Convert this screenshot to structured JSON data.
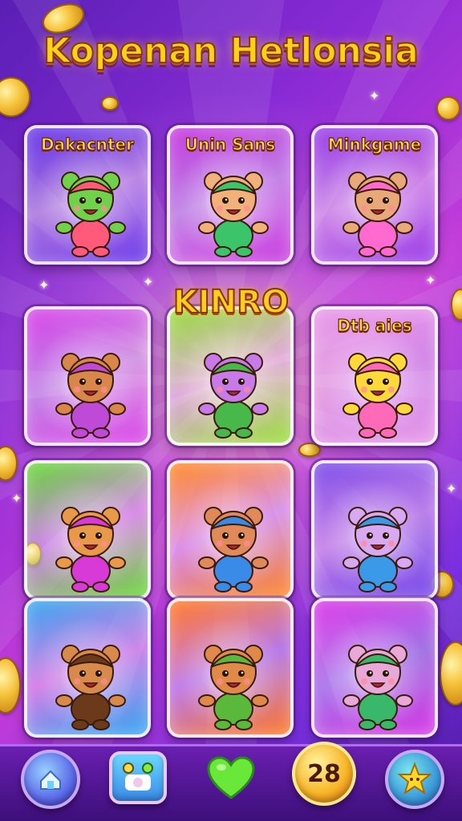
{
  "title": "Kopenan Hetlonsia",
  "featured_label": "KINRO",
  "cards": [
    {
      "label": "Dakacnter",
      "bg": "#6a3ae8",
      "body": "#6fd24a",
      "accent": "#ff5a7a",
      "character": "green-goblin"
    },
    {
      "label": "Unin Sans",
      "bg": "#c83ee0",
      "body": "#f2b07a",
      "accent": "#3cc46a",
      "character": "boy"
    },
    {
      "label": "Minkgame",
      "bg": "#9a3ee8",
      "body": "#e8a878",
      "accent": "#ff6ad0",
      "character": "girl"
    },
    {
      "label": "",
      "bg": "#d848e8",
      "body": "#d8864a",
      "accent": "#c04ad8",
      "character": "bear-cap"
    },
    {
      "label": "",
      "bg": "#9adf3c",
      "body": "#c77ae8",
      "accent": "#48b84a",
      "character": "purple-creature"
    },
    {
      "label": "Dtb aies",
      "bg": "#e89ae8",
      "body": "#ffd83a",
      "accent": "#ff6ab8",
      "character": "yellow-bear"
    },
    {
      "label": "",
      "bg": "#6ad83a",
      "body": "#e89a4a",
      "accent": "#d83ad8",
      "character": "hat-bear"
    },
    {
      "label": "",
      "bg": "#ff8a2a",
      "body": "#e08a5a",
      "accent": "#3a8ae8",
      "character": "overall-bear"
    },
    {
      "label": "",
      "bg": "#7a4ae8",
      "body": "#d8a8f0",
      "accent": "#3a9ae8",
      "character": "purple-bear"
    },
    {
      "label": "",
      "bg": "#3aa8f0",
      "body": "#d88a4a",
      "accent": "#6a3a1a",
      "character": "puppy"
    },
    {
      "label": "",
      "bg": "#ff7a2a",
      "body": "#e08a4a",
      "accent": "#5ab83a",
      "character": "hat-bear-green"
    },
    {
      "label": "",
      "bg": "#d83ae8",
      "body": "#e8a8d8",
      "accent": "#3ab86a",
      "character": "green-hair-kid"
    }
  ],
  "bottom_nav": {
    "counter": "28",
    "buttons": [
      "home-icon",
      "shop-icon",
      "heart-icon",
      "coin-counter",
      "star-icon"
    ]
  }
}
